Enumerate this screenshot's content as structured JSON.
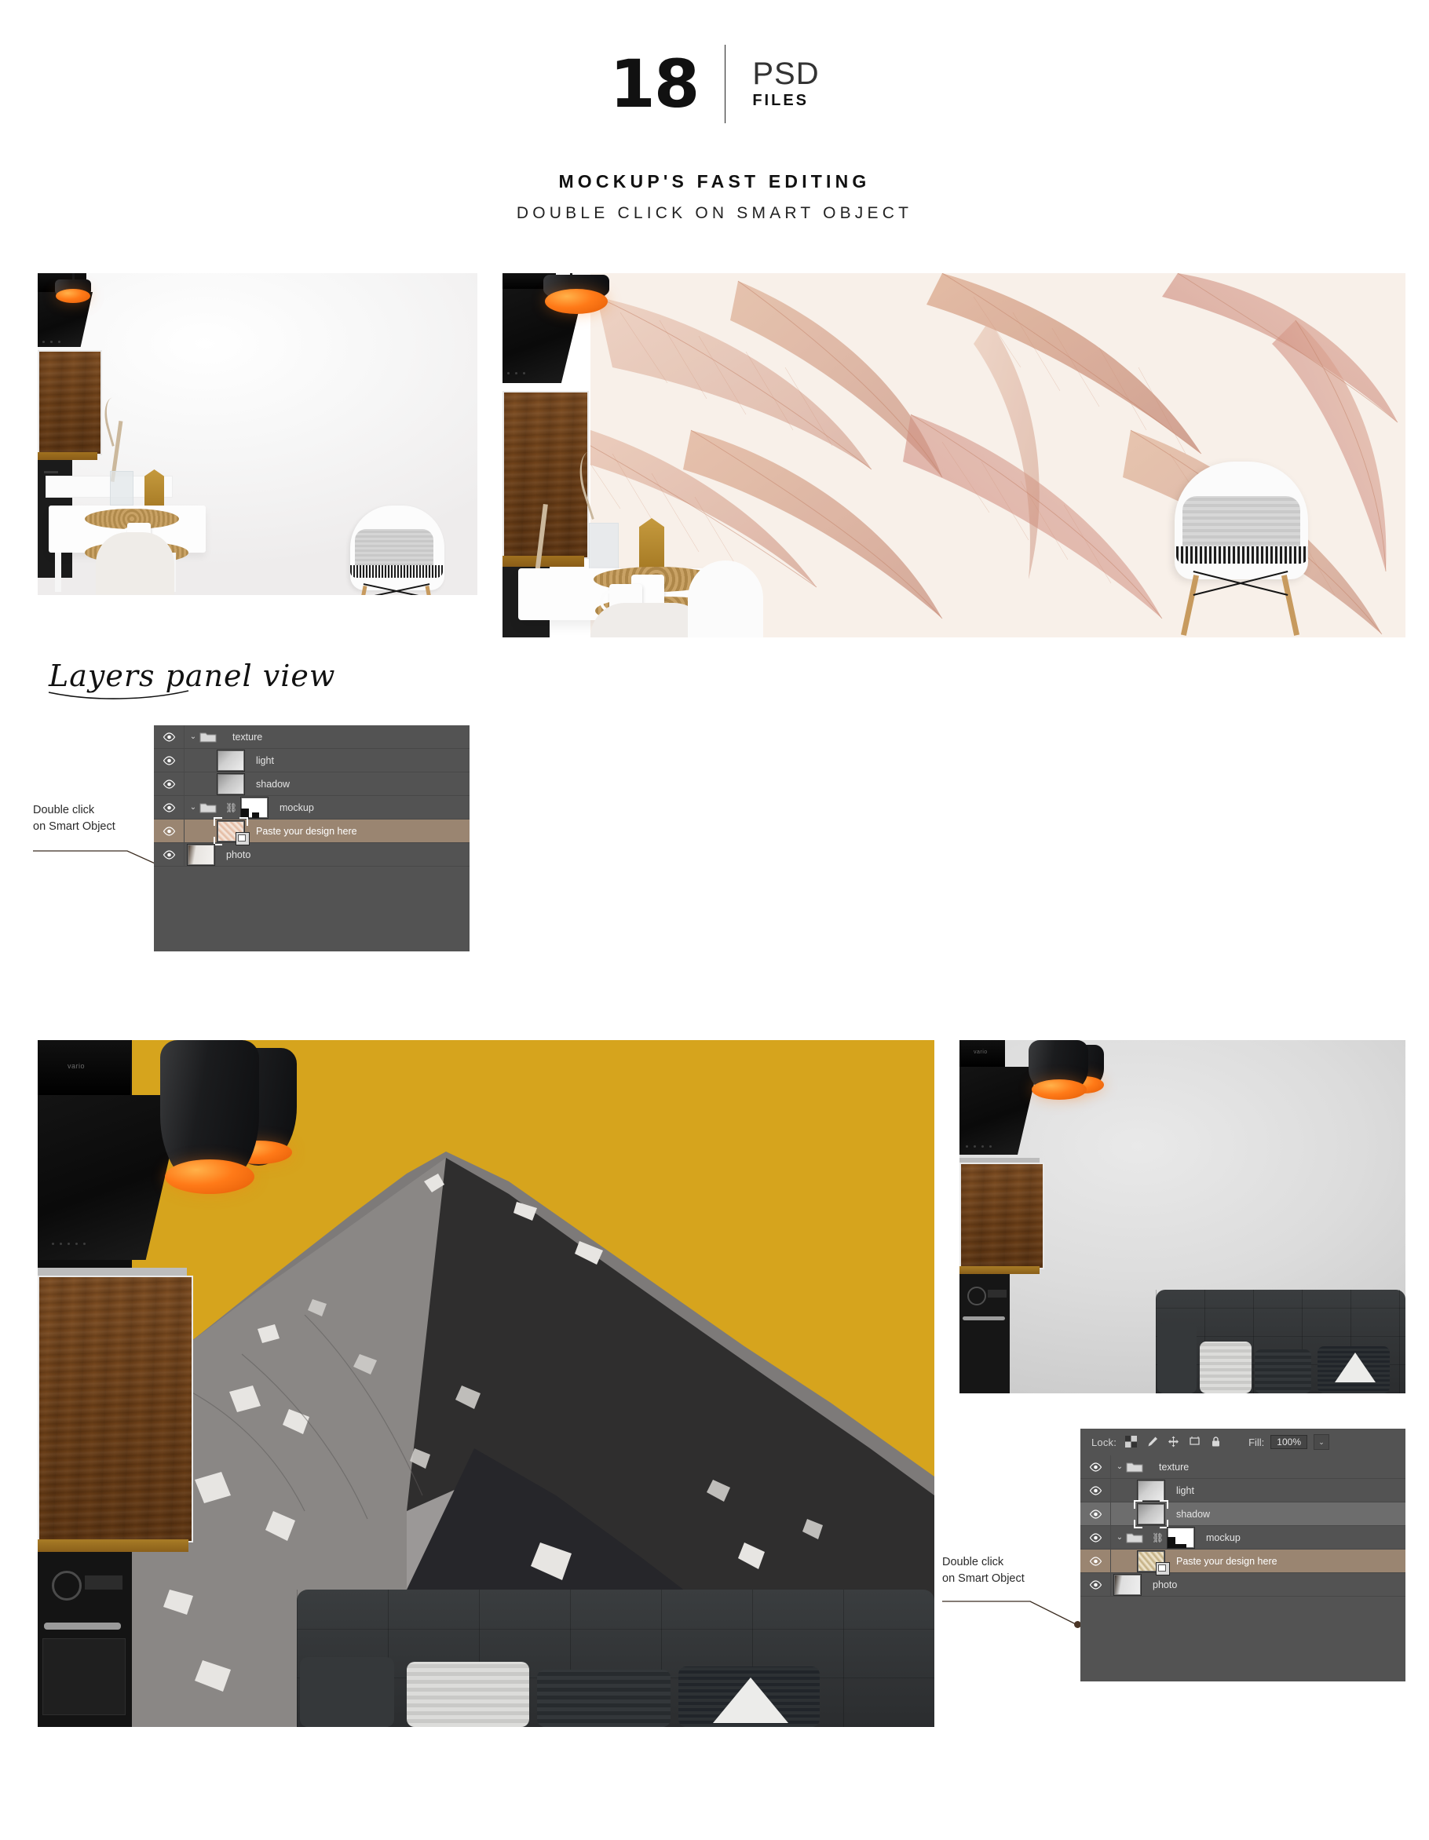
{
  "header": {
    "count": "18",
    "format": "PSD",
    "format_sub": "FILES",
    "title": "MOCKUP'S FAST EDITING",
    "subtitle": "DOUBLE CLICK ON SMART OBJECT"
  },
  "script_heading": "Layers panel view",
  "annotations": {
    "smart_object_line1": "Double click",
    "smart_object_line2": "on Smart Object"
  },
  "upper_panel": {
    "layers": [
      {
        "name": "texture",
        "type": "group",
        "visible": true,
        "expanded": true,
        "selected": false,
        "has_thumb": false,
        "has_link": false
      },
      {
        "name": "light",
        "type": "layer",
        "visible": true,
        "selected": false,
        "has_thumb": true,
        "thumb": "light-thumb"
      },
      {
        "name": "shadow",
        "type": "layer",
        "visible": true,
        "selected": false,
        "has_thumb": true,
        "thumb": "shadow-thumb"
      },
      {
        "name": "mockup",
        "type": "group",
        "visible": true,
        "expanded": true,
        "selected": false,
        "has_thumb": true,
        "thumb": "mask-thumb",
        "has_link": true
      },
      {
        "name": "Paste your design here",
        "type": "smart-object",
        "visible": true,
        "selected": true,
        "has_thumb": true,
        "thumb": "design-floral-thumb"
      },
      {
        "name": "photo",
        "type": "layer",
        "visible": true,
        "selected": false,
        "has_thumb": true,
        "thumb": "photo-thumb"
      }
    ]
  },
  "lower_panel": {
    "lock_bar": {
      "lock_label": "Lock:",
      "lock_icons": [
        "transparency-lock-icon",
        "brush-lock-icon",
        "move-lock-icon",
        "artboard-lock-icon",
        "lock-all-icon"
      ],
      "fill_label": "Fill:",
      "fill_value": "100%",
      "fill_caret": "chevron-down-icon"
    },
    "layers": [
      {
        "name": "texture",
        "type": "group",
        "visible": true,
        "expanded": true,
        "selected": false,
        "has_thumb": false,
        "has_link": false
      },
      {
        "name": "light",
        "type": "layer",
        "visible": true,
        "selected": false,
        "has_thumb": true,
        "thumb": "light-thumb"
      },
      {
        "name": "shadow",
        "type": "layer",
        "visible": true,
        "selected": "grey",
        "has_thumb": true,
        "thumb": "shadow-thumb"
      },
      {
        "name": "mockup",
        "type": "group",
        "visible": true,
        "expanded": true,
        "selected": false,
        "has_thumb": true,
        "thumb": "mask-thumb",
        "has_link": true
      },
      {
        "name": "Paste your design here",
        "type": "smart-object",
        "visible": true,
        "selected": true,
        "has_thumb": true,
        "thumb": "design-mtn-thumb"
      },
      {
        "name": "photo",
        "type": "layer",
        "visible": true,
        "selected": false,
        "has_thumb": true,
        "thumb": "photo-thumb"
      }
    ]
  },
  "photos": {
    "upper_left": {
      "label": "plain white wall kitchen nook",
      "wall_color": "#f3f2f1"
    },
    "upper_right": {
      "label": "floral leaf mural applied to wall",
      "mural_color": "#c98a6c"
    },
    "lower_left": {
      "label": "mountain mural on mustard wall",
      "mural_color": "#d6a41d"
    },
    "lower_right": {
      "label": "plain grey wall with dark sofa",
      "wall_color": "#dcdcdc"
    }
  },
  "colors": {
    "panel_bg": "#535353",
    "selected_row": "#9a8571",
    "selected_row_grey": "#6d6d6d",
    "lamp_orange": "#ff7a18",
    "mustard": "#d6a41d",
    "text_dark": "#111111"
  }
}
